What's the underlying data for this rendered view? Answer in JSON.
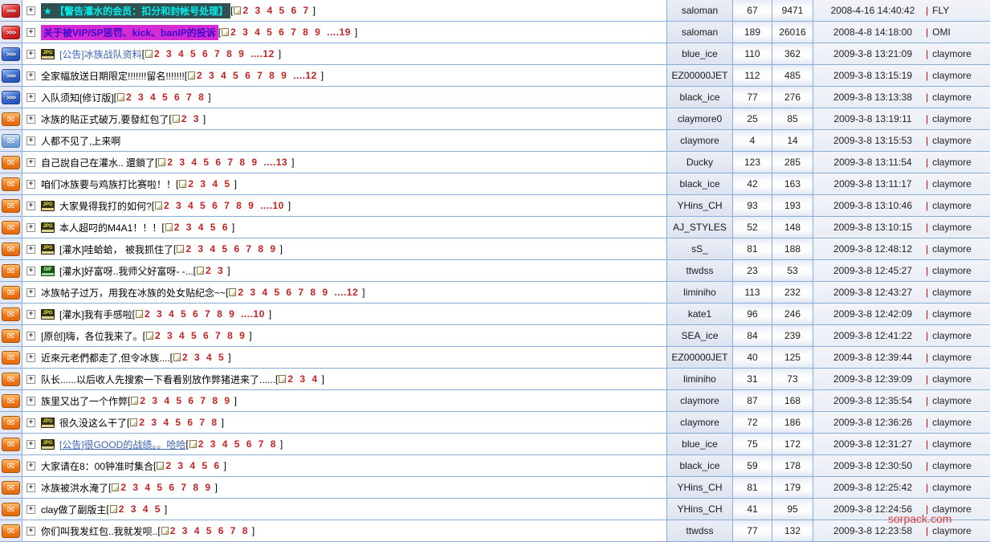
{
  "watermark": "sorpack.com",
  "icons": {
    "arrows_glyph": ">>>",
    "envelope_glyph": "✉",
    "expand_glyph": "+",
    "jpg_label": "JPG",
    "gif_label": "GIF"
  },
  "pagination": {
    "open": "[",
    "close": "]"
  },
  "lastpost_separator": "|",
  "colors": {
    "page_number_red": "#c32222",
    "border_blue": "#8aadd8",
    "highlight1_bg": "#2f5151",
    "highlight1_text": "#00eeee",
    "highlight2_bg": "#d42bd4",
    "highlight2_text": "#3a0acd",
    "link_blue": "#3c64b4",
    "separator_red": "#cc0000"
  },
  "table": {
    "rows": [
      {
        "status_icon": "red-arrows",
        "attachment": "",
        "title": "★ 【警告灌水的会员：扣分和封帐号处理】",
        "title_style": "highlight-dark-cyan",
        "pages": [
          "2",
          "3",
          "4",
          "5",
          "6",
          "7"
        ],
        "author": "saloman",
        "replies": "67",
        "views": "9471",
        "lastpost_date": "2008-4-16 14:40:42",
        "lastpost_by": "FLY"
      },
      {
        "status_icon": "red-arrows",
        "attachment": "",
        "title": "关于被VIP/SP惩罚、kick、banIP的投诉",
        "title_style": "highlight-magenta",
        "pages": [
          "2",
          "3",
          "4",
          "5",
          "6",
          "7",
          "8",
          "9",
          "....19"
        ],
        "author": "saloman",
        "replies": "189",
        "views": "26016",
        "lastpost_date": "2008-4-8 14:18:00",
        "lastpost_by": "OMI"
      },
      {
        "status_icon": "blue-arrows",
        "attachment": "jpg",
        "title": "[公告]冰族战队资料",
        "title_style": "blue",
        "pages": [
          "2",
          "3",
          "4",
          "5",
          "6",
          "7",
          "8",
          "9",
          "....12"
        ],
        "author": "blue_ice",
        "replies": "110",
        "views": "362",
        "lastpost_date": "2009-3-8 13:21:09",
        "lastpost_by": "claymore"
      },
      {
        "status_icon": "blue-arrows",
        "attachment": "",
        "title": "全家幅放送日期限定!!!!!!!留名!!!!!!!",
        "title_style": "normal",
        "pages": [
          "2",
          "3",
          "4",
          "5",
          "6",
          "7",
          "8",
          "9",
          "....12"
        ],
        "author": "EZ00000JET",
        "replies": "112",
        "views": "485",
        "lastpost_date": "2009-3-8 13:15:19",
        "lastpost_by": "claymore"
      },
      {
        "status_icon": "blue-arrows",
        "attachment": "",
        "title": "入队须知[修订版]",
        "title_style": "normal",
        "pages": [
          "2",
          "3",
          "4",
          "5",
          "6",
          "7",
          "8"
        ],
        "author": "black_ice",
        "replies": "77",
        "views": "276",
        "lastpost_date": "2009-3-8 13:13:38",
        "lastpost_by": "claymore"
      },
      {
        "status_icon": "orange-envelope",
        "attachment": "",
        "title": "冰族的贴正式破万,要發紅包了",
        "title_style": "normal",
        "pages": [
          "2",
          "3"
        ],
        "author": "claymore0",
        "replies": "25",
        "views": "85",
        "lastpost_date": "2009-3-8 13:19:11",
        "lastpost_by": "claymore"
      },
      {
        "status_icon": "blue-envelope",
        "attachment": "",
        "title": "人都不见了,上来啊",
        "title_style": "normal",
        "pages": null,
        "author": "claymore",
        "replies": "4",
        "views": "14",
        "lastpost_date": "2009-3-8 13:15:53",
        "lastpost_by": "claymore"
      },
      {
        "status_icon": "orange-envelope",
        "attachment": "",
        "title": "自己說自己在灌水.. 還鎖了",
        "title_style": "normal",
        "pages": [
          "2",
          "3",
          "4",
          "5",
          "6",
          "7",
          "8",
          "9",
          "....13"
        ],
        "author": "Ducky",
        "replies": "123",
        "views": "285",
        "lastpost_date": "2009-3-8 13:11:54",
        "lastpost_by": "claymore"
      },
      {
        "status_icon": "orange-envelope",
        "attachment": "",
        "title": "咱们冰族要与鸡族打比赛啦！！",
        "title_style": "normal",
        "pages": [
          "2",
          "3",
          "4",
          "5"
        ],
        "author": "black_ice",
        "replies": "42",
        "views": "163",
        "lastpost_date": "2009-3-8 13:11:17",
        "lastpost_by": "claymore"
      },
      {
        "status_icon": "orange-envelope",
        "attachment": "jpg",
        "title": "大家覺得我打的如何?",
        "title_style": "normal",
        "pages": [
          "2",
          "3",
          "4",
          "5",
          "6",
          "7",
          "8",
          "9",
          "....10"
        ],
        "author": "YHins_CH",
        "replies": "93",
        "views": "193",
        "lastpost_date": "2009-3-8 13:10:46",
        "lastpost_by": "claymore"
      },
      {
        "status_icon": "orange-envelope",
        "attachment": "jpg",
        "title": "本人超叼的M4A1！！！",
        "title_style": "normal",
        "pages": [
          "2",
          "3",
          "4",
          "5",
          "6"
        ],
        "author": "AJ_STYLES",
        "replies": "52",
        "views": "148",
        "lastpost_date": "2009-3-8 13:10:15",
        "lastpost_by": "claymore"
      },
      {
        "status_icon": "orange-envelope",
        "attachment": "jpg",
        "title": "[灌水]哇蛤蛤， 被我抓住了",
        "title_style": "normal",
        "pages": [
          "2",
          "3",
          "4",
          "5",
          "6",
          "7",
          "8",
          "9"
        ],
        "author": "sS_",
        "replies": "81",
        "views": "188",
        "lastpost_date": "2009-3-8 12:48:12",
        "lastpost_by": "claymore"
      },
      {
        "status_icon": "orange-envelope",
        "attachment": "gif",
        "title": "[灌水]好富呀..我师父好富呀- -...",
        "title_style": "normal",
        "pages": [
          "2",
          "3"
        ],
        "author": "ttwdss",
        "replies": "23",
        "views": "53",
        "lastpost_date": "2009-3-8 12:45:27",
        "lastpost_by": "claymore"
      },
      {
        "status_icon": "orange-envelope",
        "attachment": "",
        "title": "冰族帖子过万，用我在冰族的处女贴纪念~~",
        "title_style": "normal",
        "pages": [
          "2",
          "3",
          "4",
          "5",
          "6",
          "7",
          "8",
          "9",
          "....12"
        ],
        "author": "liminiho",
        "replies": "113",
        "views": "232",
        "lastpost_date": "2009-3-8 12:43:27",
        "lastpost_by": "claymore"
      },
      {
        "status_icon": "orange-envelope",
        "attachment": "jpg",
        "title": "[灌水]我有手感啦",
        "title_style": "normal",
        "pages": [
          "2",
          "3",
          "4",
          "5",
          "6",
          "7",
          "8",
          "9",
          "....10"
        ],
        "author": "kate1",
        "replies": "96",
        "views": "246",
        "lastpost_date": "2009-3-8 12:42:09",
        "lastpost_by": "claymore"
      },
      {
        "status_icon": "orange-envelope",
        "attachment": "",
        "title": "[原创]嗨，各位我来了。",
        "title_style": "normal",
        "pages": [
          "2",
          "3",
          "4",
          "5",
          "6",
          "7",
          "8",
          "9"
        ],
        "author": "SEA_ice",
        "replies": "84",
        "views": "239",
        "lastpost_date": "2009-3-8 12:41:22",
        "lastpost_by": "claymore"
      },
      {
        "status_icon": "orange-envelope",
        "attachment": "",
        "title": "近來元老們都走了,但令冰族....",
        "title_style": "normal",
        "pages": [
          "2",
          "3",
          "4",
          "5"
        ],
        "author": "EZ00000JET",
        "replies": "40",
        "views": "125",
        "lastpost_date": "2009-3-8 12:39:44",
        "lastpost_by": "claymore"
      },
      {
        "status_icon": "orange-envelope",
        "attachment": "",
        "title": "队长......以后收人先搜索一下看看别放作弊猪进来了......",
        "title_style": "normal",
        "pages": [
          "2",
          "3",
          "4"
        ],
        "author": "liminiho",
        "replies": "31",
        "views": "73",
        "lastpost_date": "2009-3-8 12:39:09",
        "lastpost_by": "claymore"
      },
      {
        "status_icon": "orange-envelope",
        "attachment": "",
        "title": "族里又出了一个作弊",
        "title_style": "normal",
        "pages": [
          "2",
          "3",
          "4",
          "5",
          "6",
          "7",
          "8",
          "9"
        ],
        "author": "claymore",
        "replies": "87",
        "views": "168",
        "lastpost_date": "2009-3-8 12:35:54",
        "lastpost_by": "claymore"
      },
      {
        "status_icon": "orange-envelope",
        "attachment": "jpg",
        "title": "很久没这么干了",
        "title_style": "normal",
        "pages": [
          "2",
          "3",
          "4",
          "5",
          "6",
          "7",
          "8"
        ],
        "author": "claymore",
        "replies": "72",
        "views": "186",
        "lastpost_date": "2009-3-8 12:36:26",
        "lastpost_by": "claymore"
      },
      {
        "status_icon": "orange-envelope",
        "attachment": "jpg",
        "title": "[公告]很GOOD的战绩。。哈哈",
        "title_style": "blue-underline",
        "pages": [
          "2",
          "3",
          "4",
          "5",
          "6",
          "7",
          "8"
        ],
        "author": "blue_ice",
        "replies": "75",
        "views": "172",
        "lastpost_date": "2009-3-8 12:31:27",
        "lastpost_by": "claymore"
      },
      {
        "status_icon": "orange-envelope",
        "attachment": "",
        "title": "大家请在8：00钟准时集合",
        "title_style": "normal",
        "pages": [
          "2",
          "3",
          "4",
          "5",
          "6"
        ],
        "author": "black_ice",
        "replies": "59",
        "views": "178",
        "lastpost_date": "2009-3-8 12:30:50",
        "lastpost_by": "claymore"
      },
      {
        "status_icon": "orange-envelope",
        "attachment": "",
        "title": "冰族被洪水淹了",
        "title_style": "normal",
        "pages": [
          "2",
          "3",
          "4",
          "5",
          "6",
          "7",
          "8",
          "9"
        ],
        "author": "YHins_CH",
        "replies": "81",
        "views": "179",
        "lastpost_date": "2009-3-8 12:25:42",
        "lastpost_by": "claymore"
      },
      {
        "status_icon": "orange-envelope",
        "attachment": "",
        "title": "clay做了副版主",
        "title_style": "normal",
        "pages": [
          "2",
          "3",
          "4",
          "5"
        ],
        "author": "YHins_CH",
        "replies": "41",
        "views": "95",
        "lastpost_date": "2009-3-8 12:24:56",
        "lastpost_by": "claymore"
      },
      {
        "status_icon": "orange-envelope",
        "attachment": "",
        "title": "你们叫我发红包..我就发呗..",
        "title_style": "normal",
        "pages": [
          "2",
          "3",
          "4",
          "5",
          "6",
          "7",
          "8"
        ],
        "author": "ttwdss",
        "replies": "77",
        "views": "132",
        "lastpost_date": "2009-3-8 12:23:58",
        "lastpost_by": "claymore"
      }
    ]
  }
}
